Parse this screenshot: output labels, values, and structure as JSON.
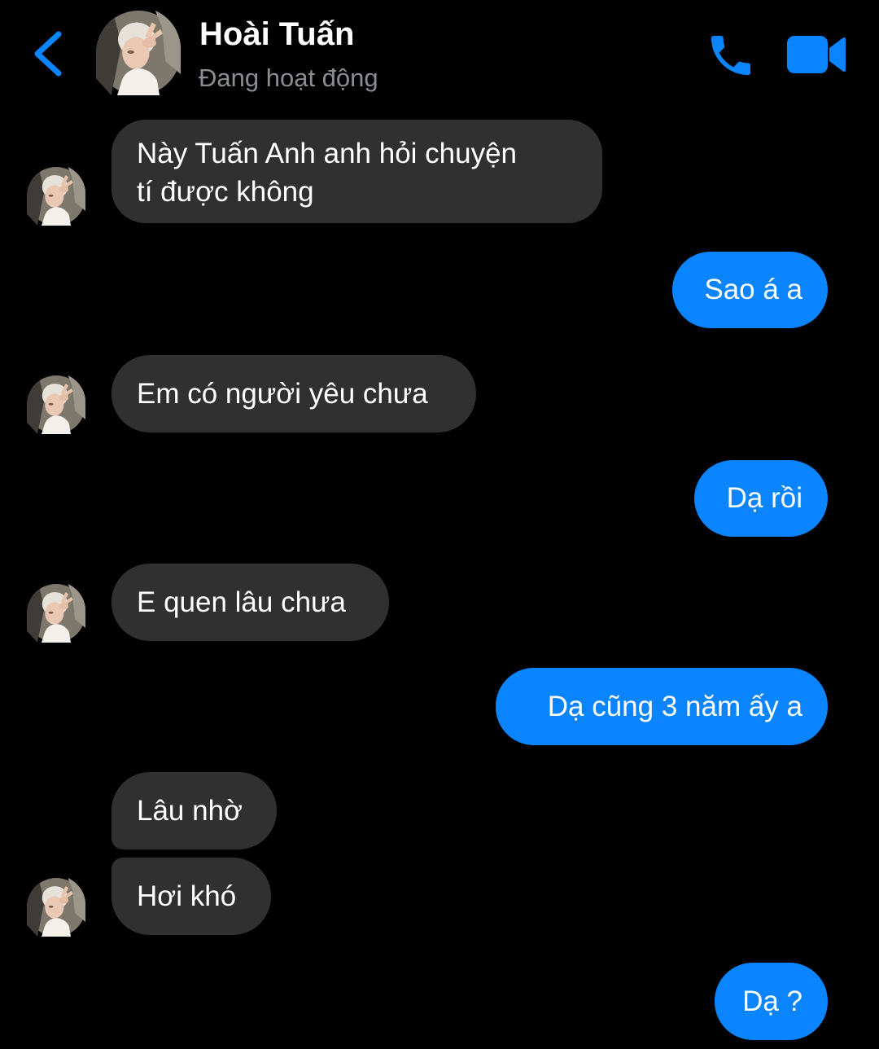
{
  "header": {
    "contact_name": "Hoài Tuấn",
    "status": "Đang hoạt động",
    "accent_color": "#0a84ff"
  },
  "messages": [
    {
      "sender": "contact",
      "text_line1": "Này Tuấn Anh anh hỏi chuyện",
      "text_line2": "tí được không"
    },
    {
      "sender": "me",
      "text": "Sao á a"
    },
    {
      "sender": "contact",
      "text": "Em có người yêu chưa"
    },
    {
      "sender": "me",
      "text": "Dạ rồi"
    },
    {
      "sender": "contact",
      "text": "E quen lâu chưa"
    },
    {
      "sender": "me",
      "text": "Dạ cũng 3 năm ấy a"
    },
    {
      "sender": "contact",
      "text": "Lâu nhờ"
    },
    {
      "sender": "contact",
      "text": "Hơi khó"
    },
    {
      "sender": "me",
      "text": "Dạ ?"
    }
  ],
  "colors": {
    "incoming_bubble": "#303030",
    "outgoing_bubble": "#0a84ff",
    "background": "#000000",
    "status_text": "#8a8d91"
  },
  "icons": [
    "back-chevron-icon",
    "phone-icon",
    "video-camera-icon"
  ]
}
